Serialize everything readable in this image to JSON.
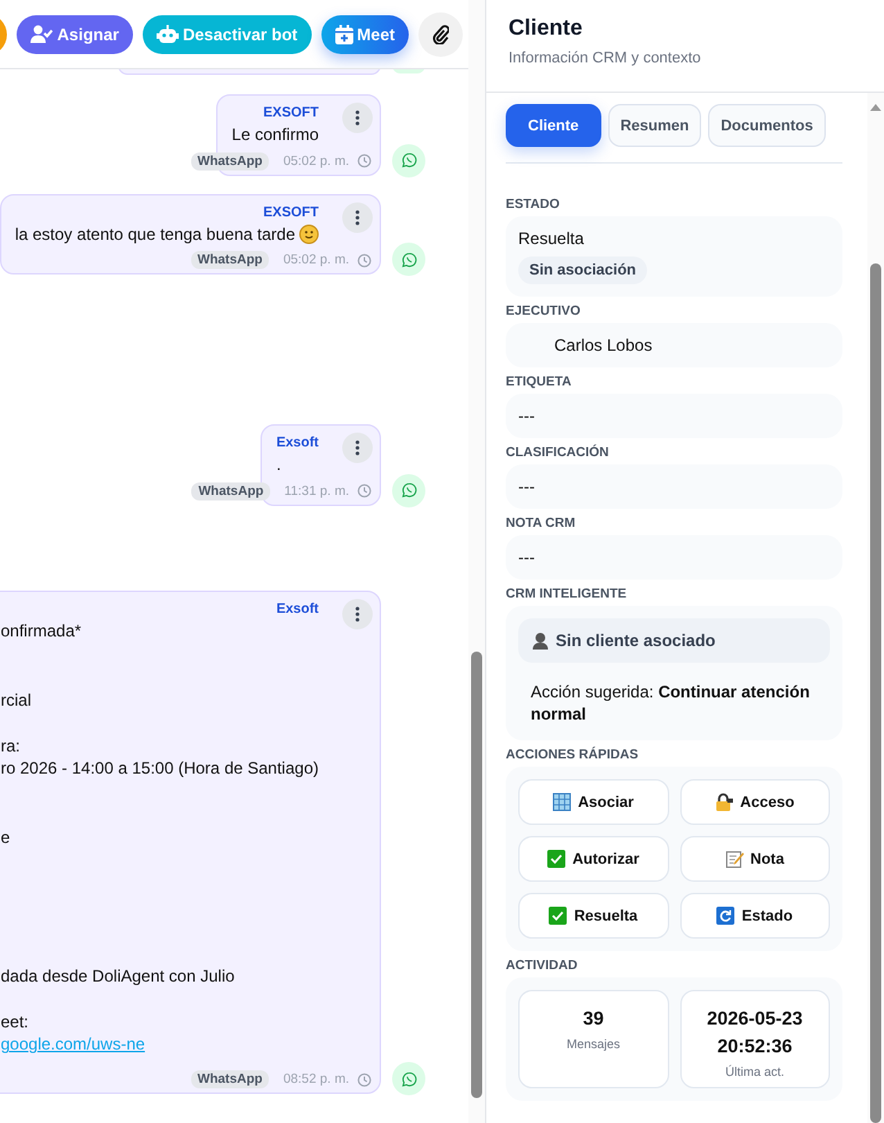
{
  "toolbar": {
    "buttons": [
      {
        "label": "Asignar",
        "kind": "assign"
      },
      {
        "label": "Desactivar bot",
        "kind": "bot"
      },
      {
        "label": "Meet",
        "kind": "meet"
      }
    ]
  },
  "messages": [
    {
      "kind": "plain",
      "sender": "EXSOFT",
      "text": "Le confirmo",
      "channel": "WhatsApp",
      "time": "05:02 p. m."
    },
    {
      "kind": "smiley",
      "sender": "EXSOFT",
      "text": "la estoy atento que tenga buena tarde",
      "channel": "WhatsApp",
      "time": "05:02 p. m."
    },
    {
      "kind": "plain",
      "sender": "Exsoft",
      "text": ".",
      "channel": "WhatsApp",
      "time": "11:31 p. m."
    },
    {
      "kind": "invite",
      "sender": "Exsoft",
      "text": "onfirmada*\n\n\nrcial\n\nra:\nro 2026 - 14:00 a 15:00 (Hora de Santiago)\n\n\ne\n\n\n\n\n\ndada desde DoliAgent con Julio\n\neet:",
      "link": "google.com/uws-ne",
      "channel": "WhatsApp",
      "time": "08:52 p. m."
    }
  ],
  "panel": {
    "title": "Cliente",
    "subtitle": "Información CRM y contexto",
    "tabs": [
      {
        "label": "Cliente",
        "selected": true
      },
      {
        "label": "Resumen",
        "selected": false
      },
      {
        "label": "Documentos",
        "selected": false
      }
    ],
    "sections": [
      {
        "label": "ESTADO",
        "kind": "status",
        "value": "Resuelta",
        "badge": "Sin asociación"
      },
      {
        "label": "EJECUTIVO",
        "kind": "person",
        "value": "Carlos Lobos"
      },
      {
        "label": "ETIQUETA",
        "kind": "text",
        "value": "---"
      },
      {
        "label": "CLASIFICACIÓN",
        "kind": "text",
        "value": "---"
      },
      {
        "label": "NOTA CRM",
        "kind": "text",
        "value": "---"
      },
      {
        "label": "CRM INTELIGENTE",
        "kind": "smart",
        "notice": "Sin cliente asociado",
        "suggestion": "Acción sugerida: **Continuar atención normal**"
      },
      {
        "label": "ACCIONES RÁPIDAS",
        "kind": "actions",
        "actions": [
          {
            "label": "Asociar",
            "kind": "building"
          },
          {
            "label": "Acceso",
            "kind": "lock"
          },
          {
            "label": "Autorizar",
            "kind": "check"
          },
          {
            "label": "Nota",
            "kind": "note"
          },
          {
            "label": "Resuelta",
            "kind": "check"
          },
          {
            "label": "Estado",
            "kind": "refresh"
          }
        ]
      },
      {
        "label": "ACTIVIDAD",
        "kind": "stats",
        "stats": [
          {
            "value": "39",
            "label": "Mensajes"
          },
          {
            "value": "2026-05-23 20:52:36",
            "label": "Última act."
          }
        ]
      }
    ]
  }
}
